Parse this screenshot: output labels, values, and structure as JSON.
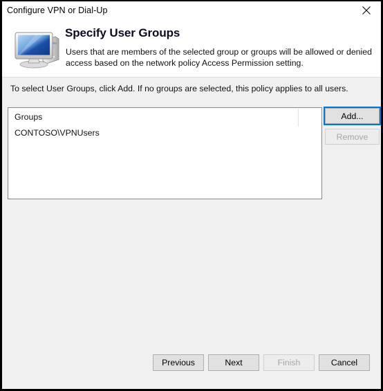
{
  "window": {
    "title": "Configure VPN or Dial-Up",
    "close_icon": "close-icon"
  },
  "header": {
    "icon": "computer-monitor-icon",
    "title": "Specify User Groups",
    "description": "Users that are members of the selected group or groups will be allowed or denied access based on the network policy Access Permission setting."
  },
  "body": {
    "instruction": "To select User Groups, click Add. If no groups are selected, this policy applies to all users."
  },
  "groups_list": {
    "column_header": "Groups",
    "items": [
      {
        "name": "CONTOSO\\VPNUsers"
      }
    ]
  },
  "side_buttons": {
    "add": "Add...",
    "remove": "Remove"
  },
  "bottom_buttons": {
    "previous": "Previous",
    "next": "Next",
    "finish": "Finish",
    "cancel": "Cancel"
  },
  "colors": {
    "focus_accent": "#0078d7",
    "window_border": "#000000",
    "body_background": "#f0f0f0",
    "header_background": "#ffffff",
    "disabled_text": "#a6a6a6"
  }
}
